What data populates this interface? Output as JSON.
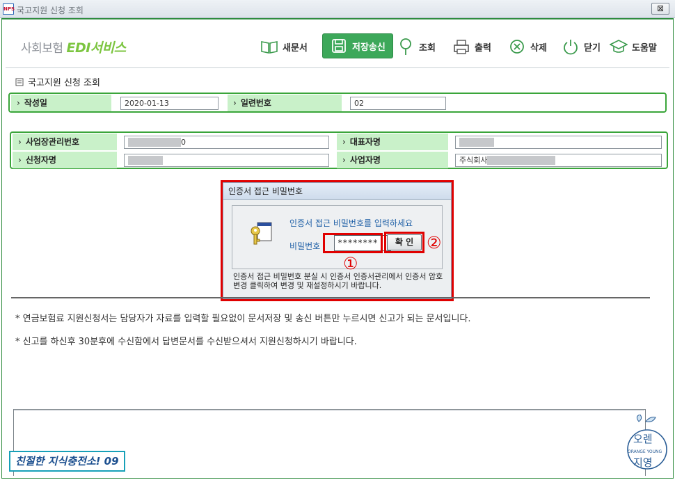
{
  "window": {
    "icon_label": "NPS",
    "title": "국고지원 신청 조회",
    "close_label": "⊠"
  },
  "brand": {
    "prefix": "사회보험 ",
    "edi": "EDI",
    "suffix": "서비스"
  },
  "toolbar": {
    "new_doc": "새문서",
    "save_send": "저장송신",
    "inquiry": "조회",
    "print": "출력",
    "delete": "삭제",
    "close": "닫기",
    "help": "도움말"
  },
  "document": {
    "title": "국고지원 신청 조회"
  },
  "form1": {
    "date_label": "작성일",
    "date_value": "2020-01-13",
    "serial_label": "일련번호",
    "serial_value": "02"
  },
  "form2": {
    "biz_mgmt_no_label": "사업장관리번호",
    "biz_mgmt_no_suffix": "0",
    "representative_label": "대표자명",
    "applicant_label": "신청자명",
    "biz_name_label": "사업자명",
    "biz_name_prefix": "주식회사"
  },
  "dialog": {
    "title": "인증서 접근 비밀번호",
    "prompt": "인증서 접근 비밀번호를 입력하세요",
    "password_label": "비밀번호 :",
    "password_value": "********",
    "ok_label": "확 인",
    "note": "인증서 접근 비밀번호 분실 시 인증서 인증서관리에서 인증서 암호변경 클릭하여 변경 및 재설정하시기 바랍니다."
  },
  "annotations": {
    "marker_1": "①",
    "marker_2": "②"
  },
  "notes": [
    "* 연금보험료 지원신청서는 담당자가 자료를 입력할 필요없이 문서저장 및 송신 버튼만 누르시면 신고가 되는 문서입니다.",
    "* 신고를 하신후 30분후에 수신함에서 답변문서를 수신받으셔서 지원신청하시기 바랍니다."
  ],
  "overlay": {
    "channel": "친절한 지식충전소! 09",
    "logo_top": "오렌",
    "logo_sub": "ORANGE YOUNG",
    "logo_bottom": "지영"
  },
  "colors": {
    "brand_green": "#3da85a",
    "label_bg": "#c9f1c9",
    "highlight_red": "#e00000"
  }
}
